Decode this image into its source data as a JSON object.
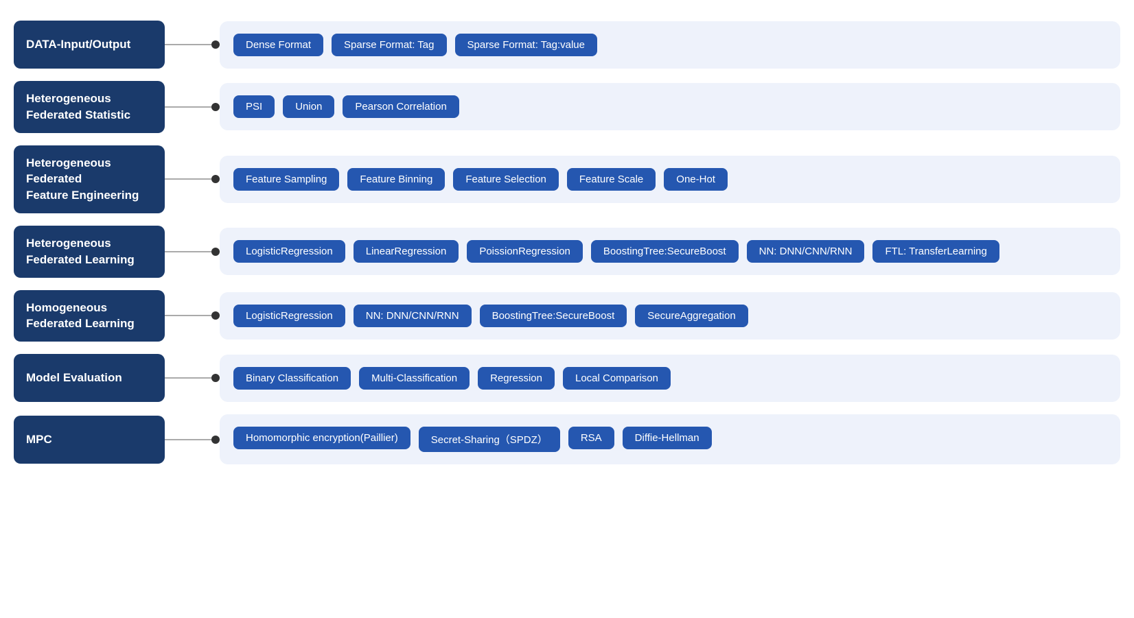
{
  "rows": [
    {
      "id": "data-input-output",
      "category": "DATA-Input/Output",
      "tags": [
        "Dense Format",
        "Sparse Format: Tag",
        "Sparse Format:  Tag:value"
      ]
    },
    {
      "id": "heterogeneous-federated-statistic",
      "category": "Heterogeneous\nFederated Statistic",
      "tags": [
        "PSI",
        "Union",
        "Pearson Correlation"
      ]
    },
    {
      "id": "heterogeneous-federated-feature-engineering",
      "category": "Heterogeneous\nFederated\nFeature Engineering",
      "tags": [
        "Feature Sampling",
        "Feature Binning",
        "Feature Selection",
        "Feature Scale",
        "One-Hot"
      ]
    },
    {
      "id": "heterogeneous-federated-learning",
      "category": "Heterogeneous\nFederated Learning",
      "tags": [
        "LogisticRegression",
        "LinearRegression",
        "PoissionRegression",
        "BoostingTree:SecureBoost",
        "NN: DNN/CNN/RNN",
        "FTL: TransferLearning"
      ]
    },
    {
      "id": "homogeneous-federated-learning",
      "category": "Homogeneous\nFederated Learning",
      "tags": [
        "LogisticRegression",
        "NN: DNN/CNN/RNN",
        "BoostingTree:SecureBoost",
        "SecureAggregation"
      ]
    },
    {
      "id": "model-evaluation",
      "category": "Model Evaluation",
      "tags": [
        "Binary Classification",
        "Multi-Classification",
        "Regression",
        "Local Comparison"
      ]
    },
    {
      "id": "mpc",
      "category": "MPC",
      "tags": [
        "Homomorphic encryption(Paillier)",
        "Secret-Sharing（SPDZ）",
        "RSA",
        "Diffie-Hellman"
      ]
    }
  ]
}
